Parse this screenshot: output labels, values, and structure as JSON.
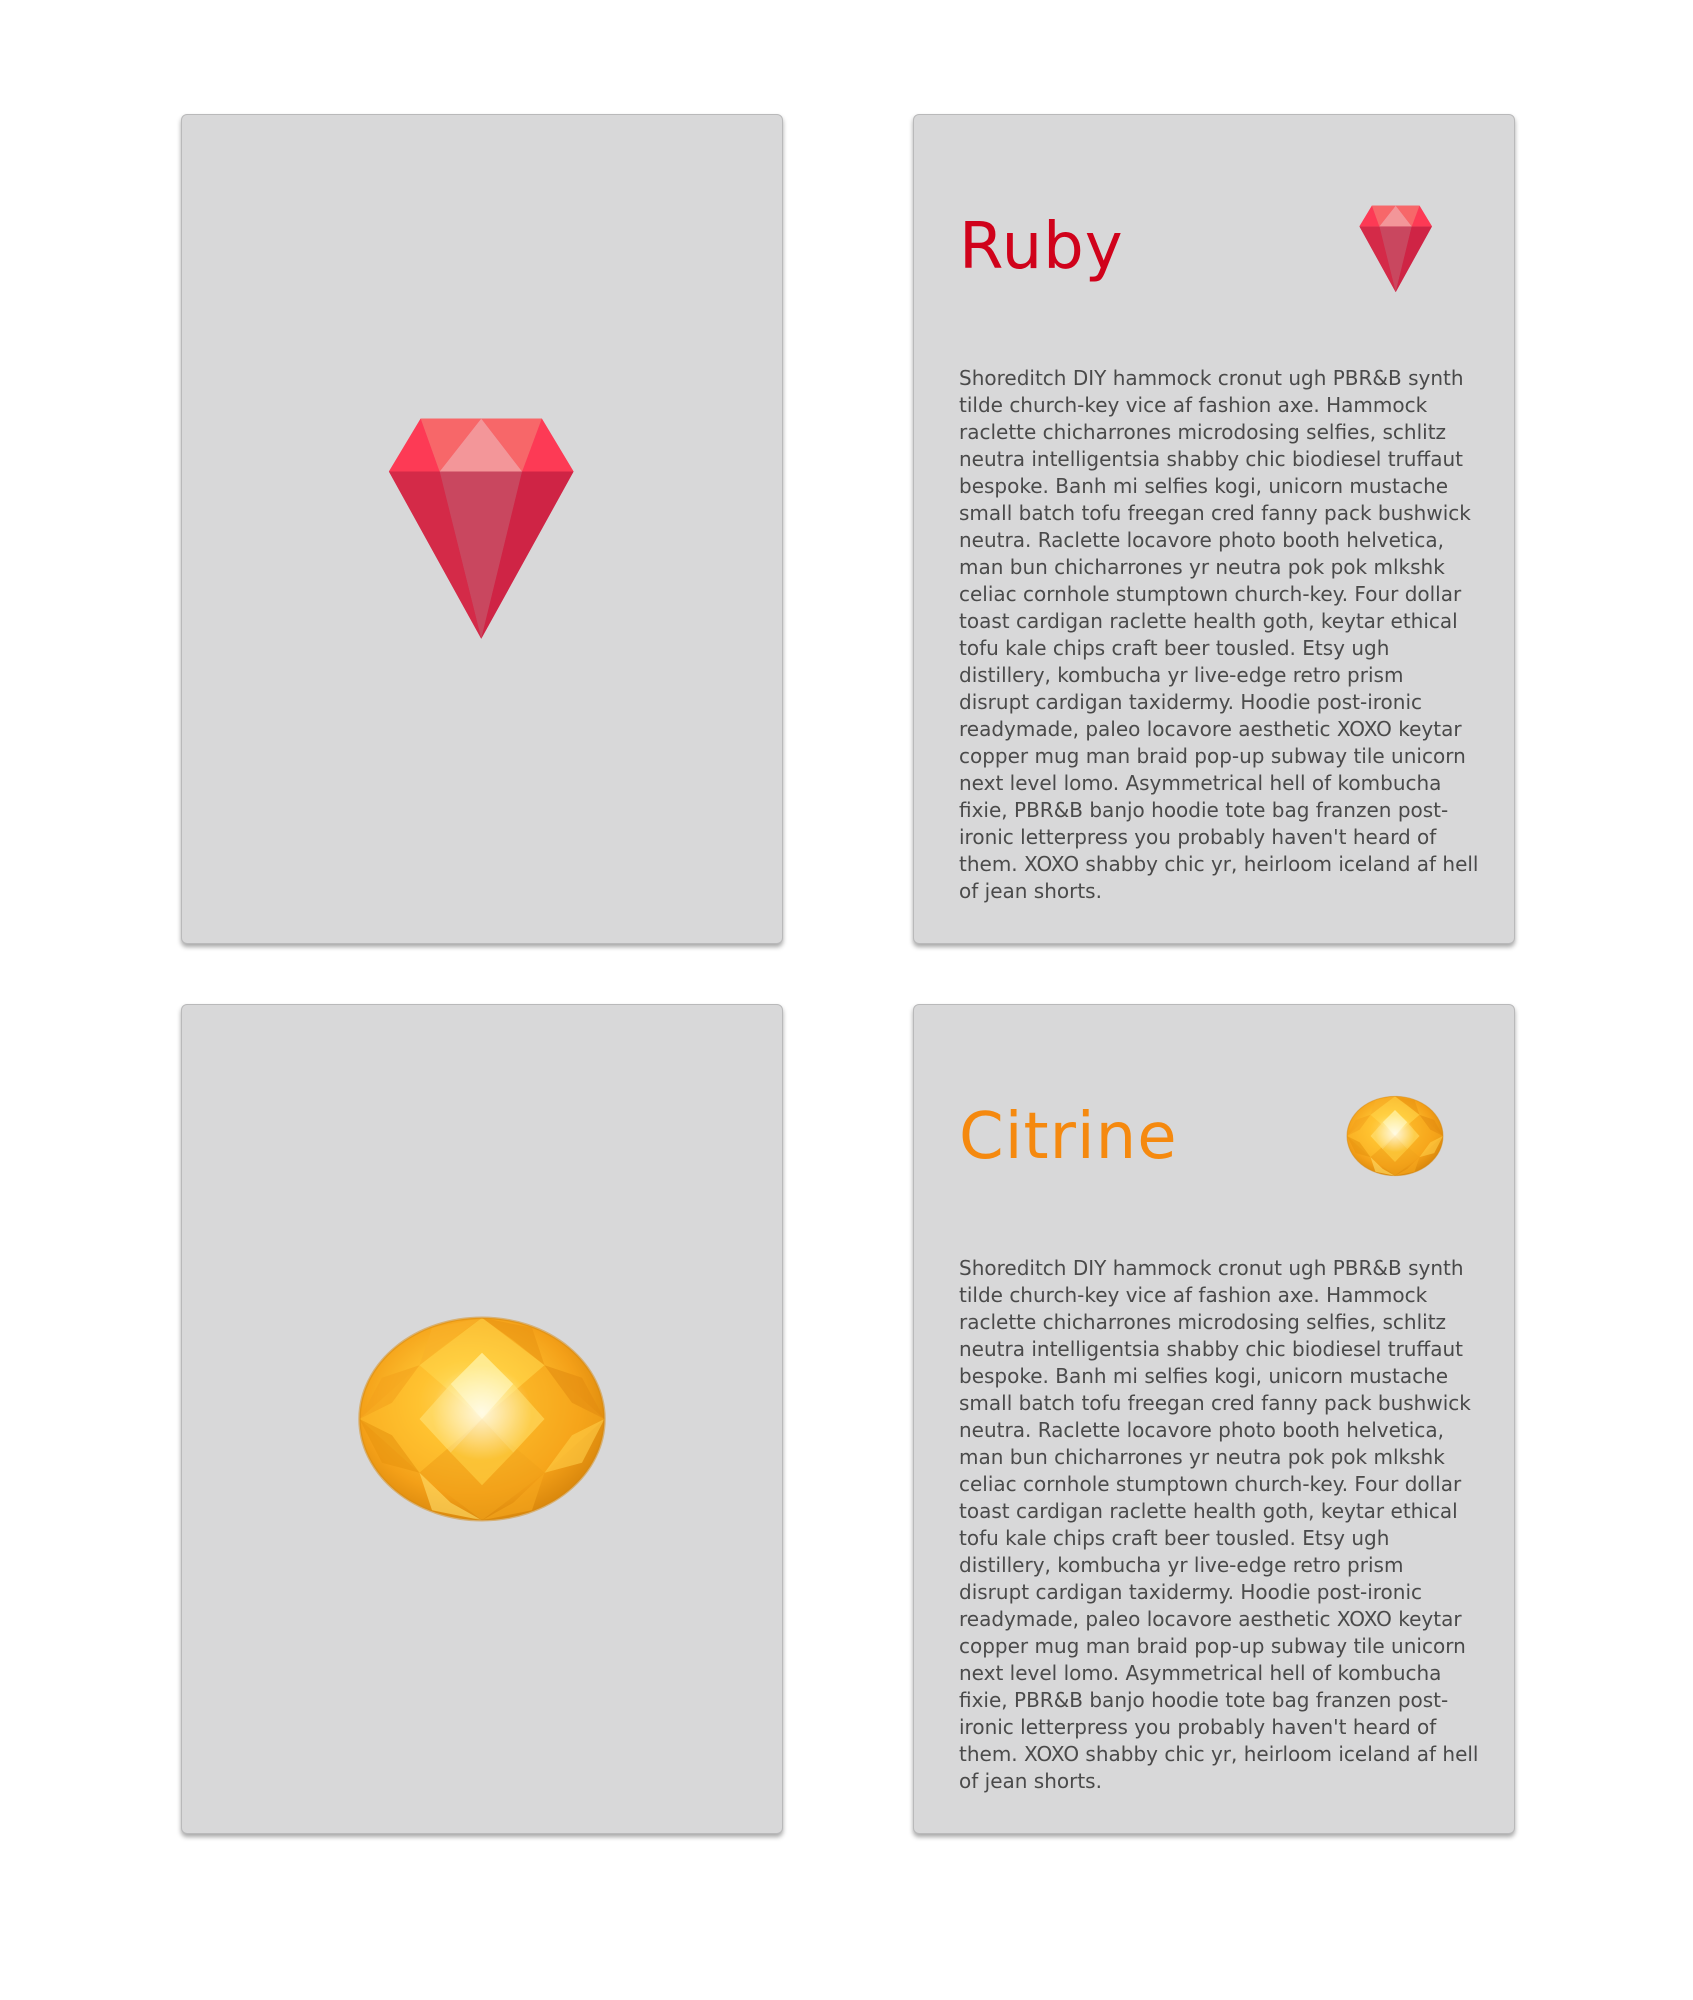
{
  "cards": [
    {
      "id": "ruby",
      "title": "Ruby",
      "accent_color": "#d0021b",
      "icon": "ruby-gem-icon",
      "body": "Shoreditch DIY hammock cronut ugh PBR&B synth tilde church-key vice af fashion axe. Hammock raclette chicharrones microdosing selfies, schlitz neutra intelligentsia shabby chic biodiesel truffaut bespoke. Banh mi selfies kogi, unicorn mustache small batch tofu freegan cred fanny pack bushwick neutra. Raclette locavore photo booth helvetica, man bun chicharrones yr neutra pok pok mlkshk celiac cornhole stumptown church-key. Four dollar toast cardigan raclette health goth, keytar ethical tofu kale chips craft beer tousled. Etsy ugh distillery, kombucha yr live-edge retro prism disrupt cardigan taxidermy. Hoodie post-ironic readymade, paleo locavore aesthetic XOXO keytar copper mug man braid pop-up subway tile unicorn next level lomo. Asymmetrical hell of kombucha fixie, PBR&B banjo hoodie tote bag franzen post-ironic letterpress you probably haven't heard of them. XOXO shabby chic yr, heirloom iceland af hell of jean shorts."
    },
    {
      "id": "citrine",
      "title": "Citrine",
      "accent_color": "#f5890f",
      "icon": "citrine-gem-icon",
      "body": "Shoreditch DIY hammock cronut ugh PBR&B synth tilde church-key vice af fashion axe. Hammock raclette chicharrones microdosing selfies, schlitz neutra intelligentsia shabby chic biodiesel truffaut bespoke. Banh mi selfies kogi, unicorn mustache small batch tofu freegan cred fanny pack bushwick neutra. Raclette locavore photo booth helvetica, man bun chicharrones yr neutra pok pok mlkshk celiac cornhole stumptown church-key. Four dollar toast cardigan raclette health goth, keytar ethical tofu kale chips craft beer tousled. Etsy ugh distillery, kombucha yr live-edge retro prism disrupt cardigan taxidermy. Hoodie post-ironic readymade, paleo locavore aesthetic XOXO keytar copper mug man braid pop-up subway tile unicorn next level lomo. Asymmetrical hell of kombucha fixie, PBR&B banjo hoodie tote bag franzen post-ironic letterpress you probably haven't heard of them. XOXO shabby chic yr, heirloom iceland af hell of jean shorts."
    }
  ]
}
